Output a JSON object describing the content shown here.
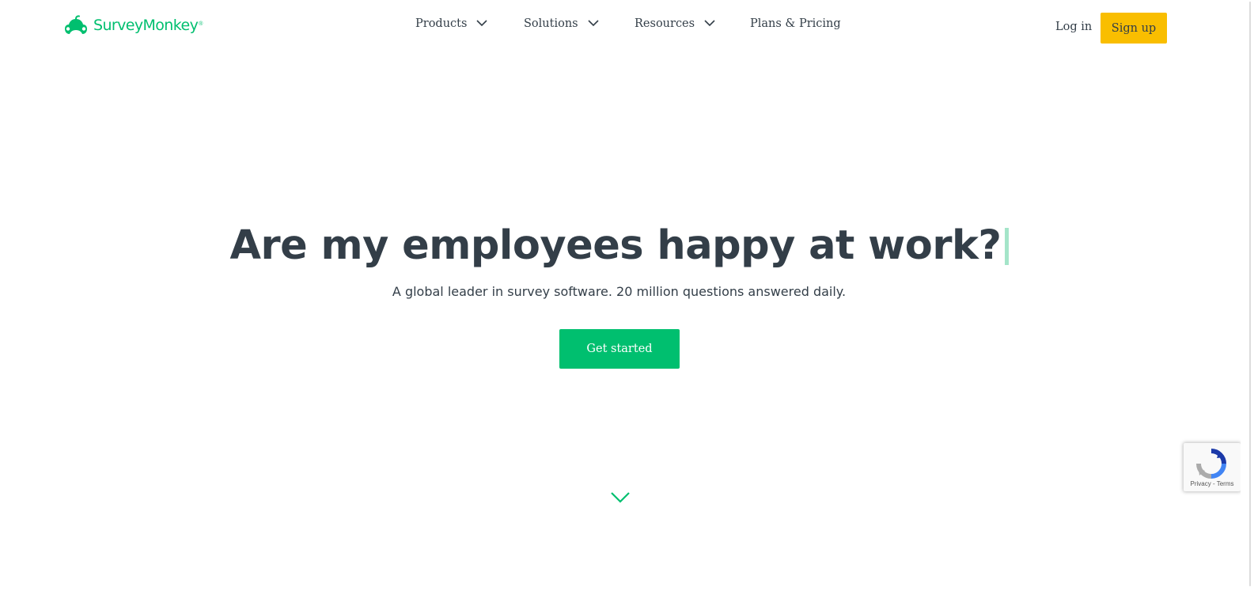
{
  "header": {
    "logo_text": "SurveyMonkey",
    "logo_mark": "®",
    "nav": [
      {
        "label": "Products"
      },
      {
        "label": "Solutions"
      },
      {
        "label": "Resources"
      },
      {
        "label": "Plans & Pricing"
      }
    ],
    "login_label": "Log in",
    "signup_label": "Sign up"
  },
  "hero": {
    "headline": "Are my employees happy at work?",
    "subheadline": "A global leader in survey software. 20 million questions answered daily.",
    "cta_label": "Get started"
  },
  "recaptcha": {
    "privacy_label": "Privacy",
    "separator": " - ",
    "terms_label": "Terms"
  },
  "colors": {
    "brand_green": "#00bf6f",
    "signup_yellow": "#f9be00",
    "text_dark": "#333e48",
    "caret_green": "#a4e5c9"
  },
  "icons": {
    "logo": "monkey-logo-icon",
    "nav_chevron": "chevron-down-icon",
    "scroll": "chevron-down-icon",
    "recaptcha": "recaptcha-icon"
  }
}
